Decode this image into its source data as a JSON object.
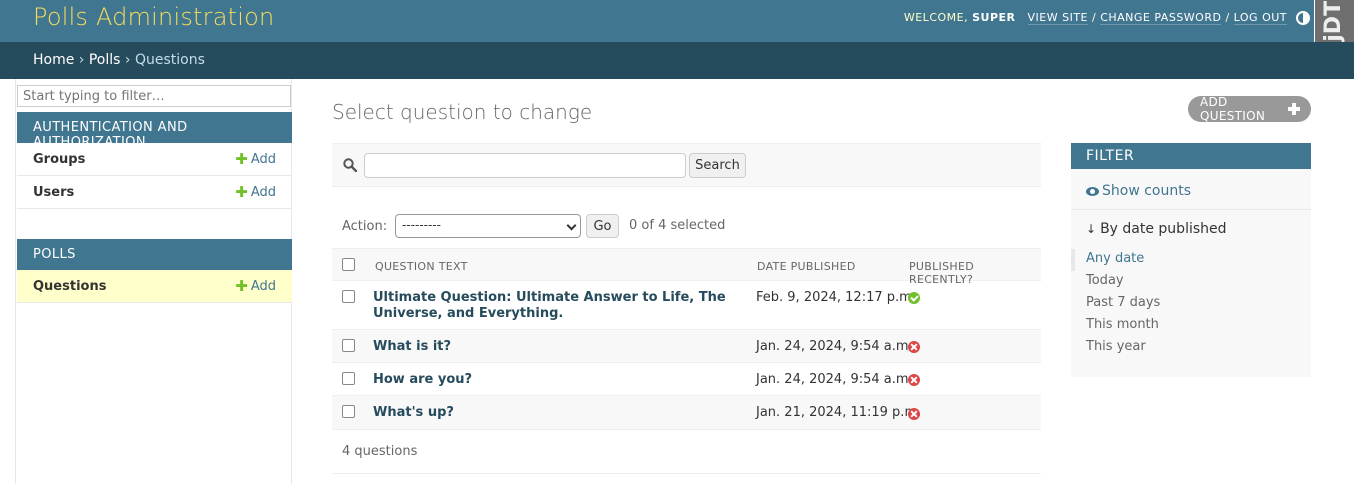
{
  "header": {
    "site_name": "Polls Administration",
    "welcome": "Welcome, ",
    "username": "super",
    "view_site": "View site",
    "change_password": "Change password",
    "log_out": "Log out",
    "sep": " / ",
    "toolbar_handle": "DjDT"
  },
  "breadcrumbs": {
    "home": "Home",
    "app": "Polls",
    "current": "Questions",
    "arrow": "›"
  },
  "sidebar": {
    "filter_placeholder": "Start typing to filter…",
    "modules": [
      {
        "caption": "Authentication and Authorization",
        "models": [
          {
            "name": "Groups",
            "add": "Add"
          },
          {
            "name": "Users",
            "add": "Add"
          }
        ]
      },
      {
        "caption": "Polls",
        "models": [
          {
            "name": "Questions",
            "add": "Add"
          }
        ]
      }
    ]
  },
  "content": {
    "title": "Select question to change",
    "add_button": "Add question",
    "search_button": "Search",
    "search_value": "",
    "action_label": "Action:",
    "action_selected": "---------",
    "go_button": "Go",
    "selected_count": "0 of 4 selected",
    "columns": [
      "Question text",
      "Date published",
      "Published recently?"
    ],
    "rows": [
      {
        "text": "Ultimate Question: Ultimate Answer to Life, The Universe, and Everything.",
        "date": "Feb. 9, 2024, 12:17 p.m.",
        "recent": true
      },
      {
        "text": "What is it?",
        "date": "Jan. 24, 2024, 9:54 a.m.",
        "recent": false
      },
      {
        "text": "How are you?",
        "date": "Jan. 24, 2024, 9:54 a.m.",
        "recent": false
      },
      {
        "text": "What's up?",
        "date": "Jan. 21, 2024, 11:19 p.m.",
        "recent": false
      }
    ],
    "paginator": "4 questions"
  },
  "filter": {
    "title": "Filter",
    "show_counts": "Show counts",
    "heading": "By date published",
    "options": [
      "Any date",
      "Today",
      "Past 7 days",
      "This month",
      "This year"
    ],
    "selected_option": "Any date"
  },
  "colors": {
    "header_bg": "#417690",
    "breadcrumb_bg": "#264b5d",
    "brand_yellow": "#f5dd5d",
    "add_green": "#70bf2b",
    "no_red": "#dd4646",
    "current_model_bg": "#ffffcc"
  },
  "icons": {
    "search": "search-icon",
    "add": "plus-icon",
    "eye": "eye-icon",
    "arrow": "down-arrow-icon",
    "theme": "theme-toggle-icon",
    "yes": "check-circle-icon",
    "no": "x-circle-icon"
  }
}
